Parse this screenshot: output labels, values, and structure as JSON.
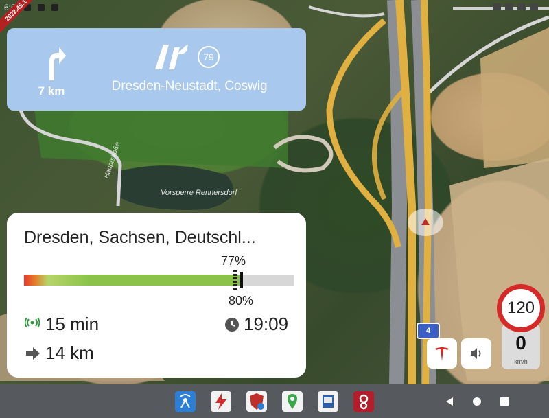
{
  "status_bar": {
    "time": "6:5",
    "version_ribbon": "2022.45.1"
  },
  "nav_card": {
    "distance": "7 km",
    "exit_number": "79",
    "destination": "Dresden-Neustadt, Coswig"
  },
  "map": {
    "place_label": "Vorsperre Rennersdorf",
    "street_label": "Hauptstraße",
    "road_shield": "4"
  },
  "trip": {
    "destination": "Dresden, Sachsen, Deutschl...",
    "battery_arrival_pct": "77%",
    "battery_target_pct": "80%",
    "battery_fill_fraction": 0.77,
    "battery_target_fraction": 0.8,
    "duration": "15 min",
    "eta": "19:09",
    "remaining_distance": "14 km"
  },
  "speed": {
    "limit": "120",
    "current": "0",
    "unit": "km/h"
  },
  "dock": {
    "apps": [
      "antenna-app-icon",
      "lightning-app-icon",
      "shield-app-icon",
      "maps-app-icon",
      "book-app-icon",
      "gear-app-icon"
    ]
  },
  "colors": {
    "nav_card": "#a8c8ee",
    "speed_ring": "#d52a2a",
    "battery_fill": "#8bc34a",
    "route": "#e0b040"
  }
}
